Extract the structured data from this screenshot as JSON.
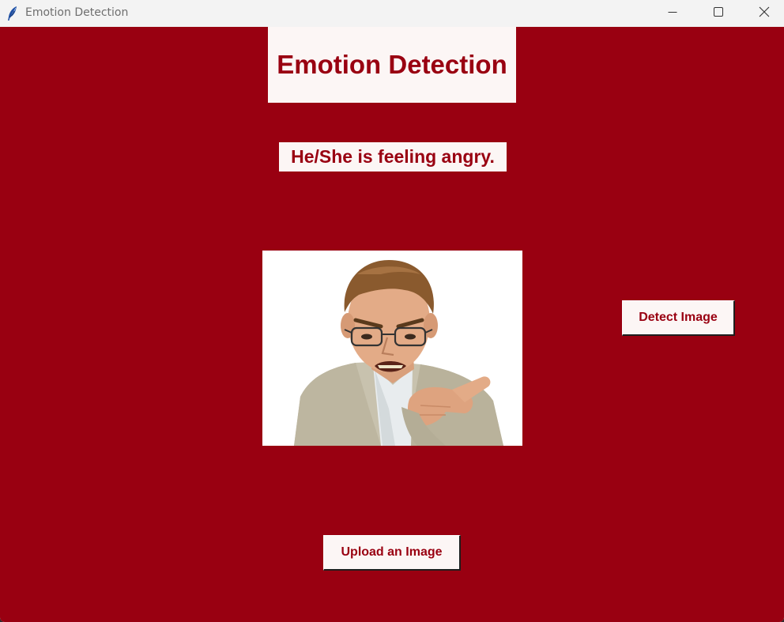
{
  "window": {
    "title": "Emotion Detection",
    "app_icon": "feather-icon",
    "controls": [
      "minimize-icon",
      "maximize-icon",
      "close-icon"
    ]
  },
  "colors": {
    "background": "#990011",
    "panel": "#fcf6f5",
    "text": "#990011",
    "titlebar": "#f3f3f3"
  },
  "main": {
    "heading": "Emotion Detection",
    "result": "He/She is feeling angry."
  },
  "buttons": {
    "detect_label": "Detect Image",
    "upload_label": "Upload an Image"
  },
  "photo": {
    "subject": "angry man in glasses pointing"
  }
}
